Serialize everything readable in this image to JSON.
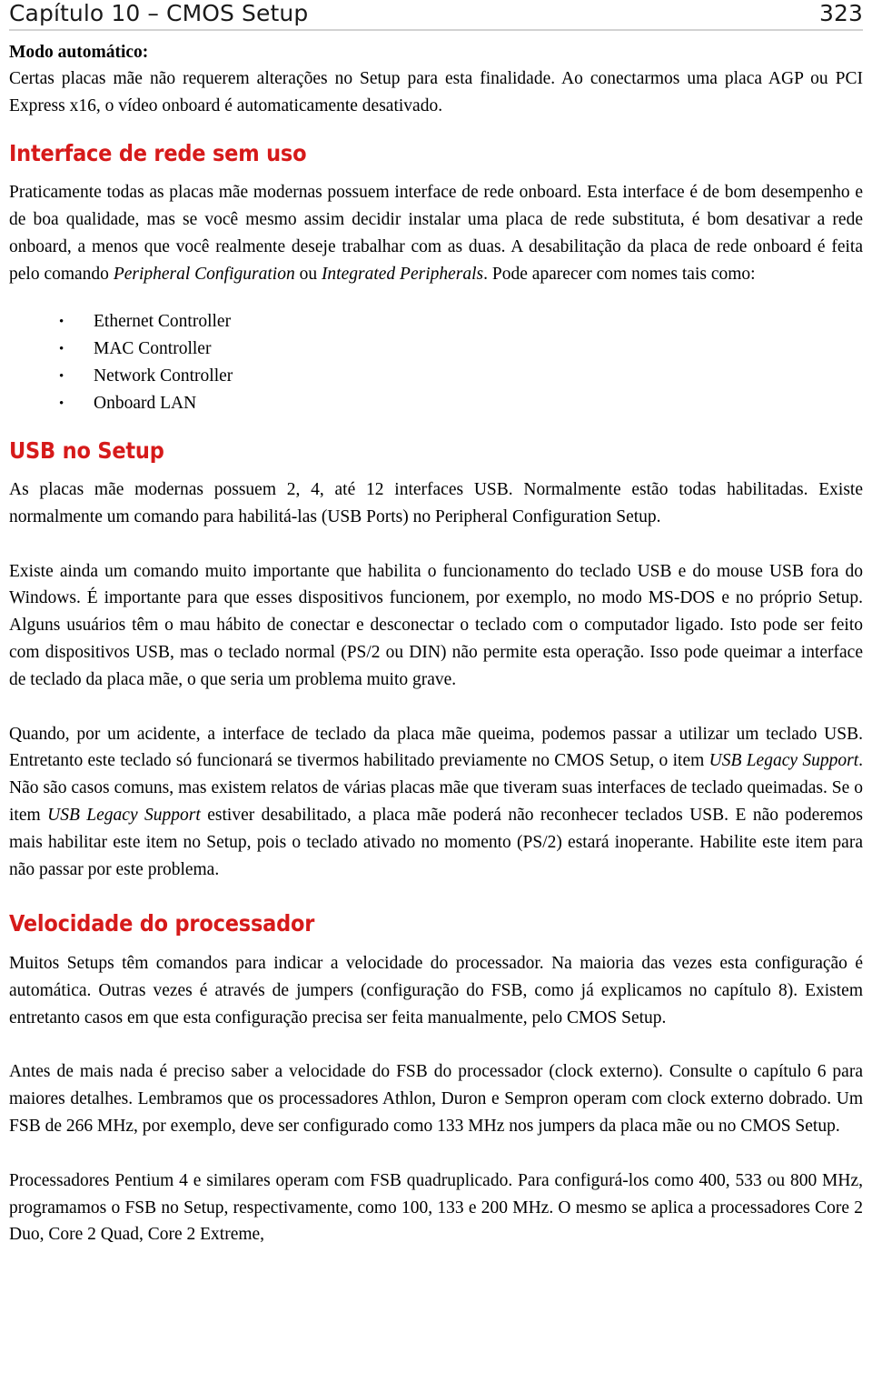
{
  "header": {
    "chapter_title": "Capítulo 10 – CMOS Setup",
    "page_number": "323"
  },
  "content": {
    "auto_mode": {
      "lead_label": "Modo automático:",
      "paragraph": "Certas placas mãe não requerem alterações no Setup para esta finalidade. Ao conectarmos uma placa AGP ou PCI Express x16, o vídeo onboard é automaticamente desativado."
    },
    "network_section": {
      "heading": "Interface de rede sem uso",
      "paragraph_part1": "Praticamente todas as placas mãe modernas possuem interface de rede onboard. Esta interface é de bom desempenho e de boa qualidade, mas se você mesmo assim decidir instalar uma placa de rede substituta, é bom desativar a rede onboard, a menos que você realmente deseje trabalhar com as duas. A desabilitação da placa de rede onboard é feita pelo comando ",
      "italic_term1": "Peripheral Configuration",
      "paragraph_mid": " ou ",
      "italic_term2": "Integrated Peripherals",
      "paragraph_part2": ". Pode aparecer com nomes tais como:",
      "bullets": [
        {
          "marker": "•",
          "label": "Ethernet Controller"
        },
        {
          "marker": "•",
          "label": "MAC Controller"
        },
        {
          "marker": "•",
          "label": "Network Controller"
        },
        {
          "marker": "•",
          "label": "Onboard LAN"
        }
      ]
    },
    "usb_section": {
      "heading": "USB no Setup",
      "paragraph1": "As placas mãe modernas possuem 2, 4, até 12 interfaces USB. Normalmente estão todas habilitadas. Existe normalmente um comando para habilitá-las (USB Ports) no Peripheral Configuration Setup.",
      "paragraph2": "Existe ainda um comando muito importante que habilita o funcionamento do teclado USB e do mouse USB fora do Windows. É importante para que esses dispositivos funcionem, por exemplo, no modo MS-DOS e no próprio Setup. Alguns usuários têm o mau hábito de conectar e desconectar o teclado com o computador ligado. Isto pode ser feito com dispositivos USB, mas o teclado normal (PS/2 ou DIN) não permite esta operação. Isso pode queimar a interface de teclado da placa mãe, o que seria um problema muito grave.",
      "paragraph3_part1": "Quando, por um acidente, a interface de teclado da placa mãe queima, podemos passar a utilizar um teclado USB. Entretanto este teclado só funcionará se tivermos habilitado previamente no CMOS Setup, o item ",
      "italic_term1": "USB Legacy Support",
      "paragraph3_part2": ". Não são casos comuns, mas existem relatos de várias placas mãe que tiveram suas interfaces de teclado queimadas. Se o item ",
      "italic_term2": "USB Legacy Support",
      "paragraph3_part3": " estiver desabilitado, a placa mãe poderá não reconhecer teclados USB. E não poderemos mais habilitar este item no Setup, pois o teclado ativado no momento (PS/2) estará inoperante. Habilite este item para não passar por este problema."
    },
    "cpu_speed_section": {
      "heading": "Velocidade do processador",
      "paragraph1": "Muitos Setups têm comandos para indicar a velocidade do processador. Na maioria das vezes esta configuração é automática. Outras vezes é através de jumpers (configuração do FSB, como já explicamos no capítulo 8). Existem entretanto casos em que esta configuração precisa ser feita manualmente, pelo CMOS Setup.",
      "paragraph2": "Antes de mais nada é preciso saber a velocidade do FSB do processador (clock externo). Consulte o capítulo 6 para maiores detalhes. Lembramos que os processadores Athlon, Duron e Sempron operam com clock externo dobrado. Um FSB de 266 MHz, por exemplo, deve ser configurado como 133 MHz nos jumpers da placa mãe ou no CMOS Setup.",
      "paragraph3": "Processadores Pentium 4 e similares operam com FSB quadruplicado. Para configurá-los como 400, 533 ou 800 MHz, programamos o FSB no Setup, respectivamente, como 100, 133 e 200 MHz. O mesmo se aplica a processadores Core 2 Duo, Core 2 Quad, Core 2 Extreme,"
    }
  },
  "colors": {
    "heading_red": "#d61a1a",
    "header_rule": "#d2d2d2",
    "body_text": "#000000"
  }
}
